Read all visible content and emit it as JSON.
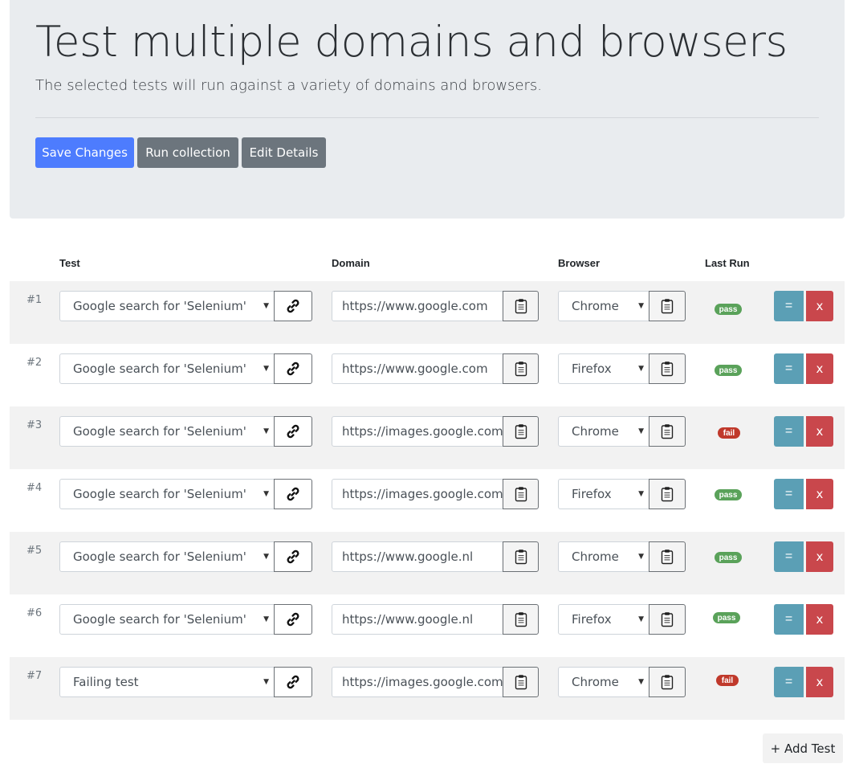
{
  "header": {
    "title": "Test multiple domains and browsers",
    "lead": "The selected tests will run against a variety of domains and browsers.",
    "buttons": {
      "save": "Save Changes",
      "run": "Run collection",
      "edit": "Edit Details"
    }
  },
  "table": {
    "columns": {
      "test": "Test",
      "domain": "Domain",
      "browser": "Browser",
      "last_run": "Last Run"
    },
    "rows": [
      {
        "num": "#1",
        "test": "Google search for 'Selenium'",
        "domain": "https://www.google.com",
        "browser": "Chrome",
        "status": "pass"
      },
      {
        "num": "#2",
        "test": "Google search for 'Selenium'",
        "domain": "https://www.google.com",
        "browser": "Firefox",
        "status": "pass"
      },
      {
        "num": "#3",
        "test": "Google search for 'Selenium'",
        "domain": "https://images.google.com",
        "browser": "Chrome",
        "status": "fail"
      },
      {
        "num": "#4",
        "test": "Google search for 'Selenium'",
        "domain": "https://images.google.com",
        "browser": "Firefox",
        "status": "pass"
      },
      {
        "num": "#5",
        "test": "Google search for 'Selenium'",
        "domain": "https://www.google.nl",
        "browser": "Chrome",
        "status": "pass"
      },
      {
        "num": "#6",
        "test": "Google search for 'Selenium'",
        "domain": "https://www.google.nl",
        "browser": "Firefox",
        "status": "pass"
      },
      {
        "num": "#7",
        "test": "Failing test",
        "domain": "https://images.google.com",
        "browser": "Chrome",
        "status": "fail"
      }
    ],
    "row_actions": {
      "reorder_label": "=",
      "delete_label": "x"
    }
  },
  "footer": {
    "add_test": "+ Add Test"
  },
  "icons": {
    "link": "link-icon",
    "clipboard": "clipboard-icon",
    "caret": "caret-down-icon"
  },
  "colors": {
    "primary": "#4d7cfe",
    "secondary": "#6c757d",
    "pass": "#5aa25a",
    "fail": "#c0392b",
    "info": "#5b9fb5",
    "danger": "#c9474c"
  }
}
